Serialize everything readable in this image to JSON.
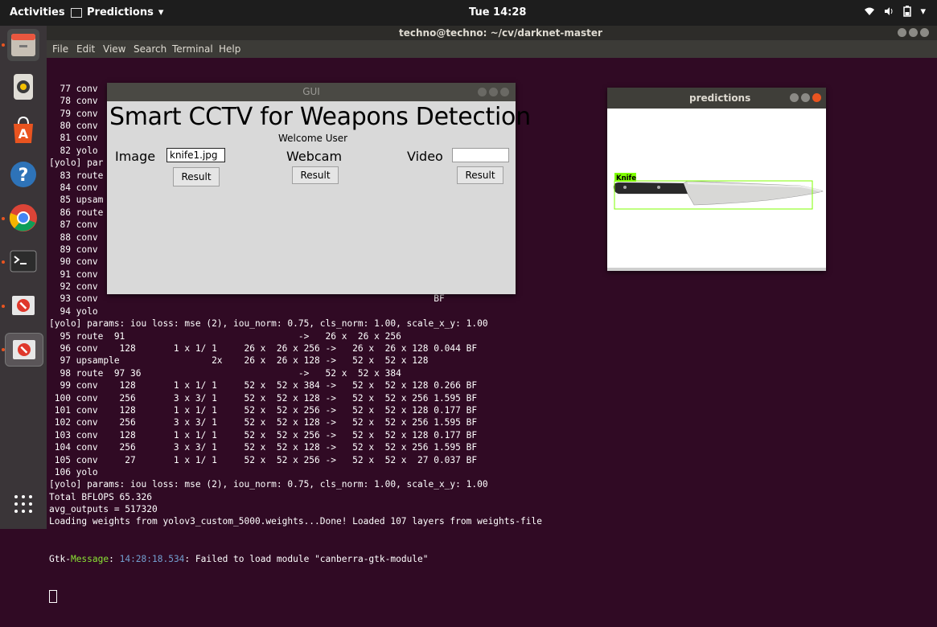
{
  "topbar": {
    "activities": "Activities",
    "app_name": "Predictions",
    "app_caret": "▾",
    "clock": "Tue 14:28",
    "wifi_icon": "wifi-icon",
    "volume_icon": "volume-icon",
    "battery_icon": "battery-icon",
    "caret": "▾"
  },
  "terminal": {
    "title": "techno@techno: ~/cv/darknet-master",
    "menu": [
      "File",
      "Edit",
      "View",
      "Search",
      "Terminal",
      "Help"
    ],
    "lines": [
      "  77 conv    512       1 x 1/ 1     13 x  13 x1024 ->   13 x  13 x 512 0.177 BF",
      "  78 conv   1024       3 x 3/ 1     13 x  13 x 512 ->   13 x  13 x1024 1.595 BF",
      "  79 conv                                                              BF",
      "  80 conv                                                              BF",
      "  81 conv                                                              BF",
      "  82 yolo",
      "[yolo] par                                                             1.00",
      "  83 route",
      "  84 conv                                                              BF",
      "  85 upsam",
      "  86 route",
      "  87 conv                                                              BF",
      "  88 conv                                                              BF",
      "  89 conv                                                              BF",
      "  90 conv                                                              BF",
      "  91 conv                                                              BF",
      "  92 conv                                                              BF",
      "  93 conv                                                              BF",
      "  94 yolo",
      "[yolo] params: iou loss: mse (2), iou_norm: 0.75, cls_norm: 1.00, scale_x_y: 1.00",
      "  95 route  91                                ->   26 x  26 x 256",
      "  96 conv    128       1 x 1/ 1     26 x  26 x 256 ->   26 x  26 x 128 0.044 BF",
      "  97 upsample                 2x    26 x  26 x 128 ->   52 x  52 x 128",
      "  98 route  97 36                             ->   52 x  52 x 384",
      "  99 conv    128       1 x 1/ 1     52 x  52 x 384 ->   52 x  52 x 128 0.266 BF",
      " 100 conv    256       3 x 3/ 1     52 x  52 x 128 ->   52 x  52 x 256 1.595 BF",
      " 101 conv    128       1 x 1/ 1     52 x  52 x 256 ->   52 x  52 x 128 0.177 BF",
      " 102 conv    256       3 x 3/ 1     52 x  52 x 128 ->   52 x  52 x 256 1.595 BF",
      " 103 conv    128       1 x 1/ 1     52 x  52 x 256 ->   52 x  52 x 128 0.177 BF",
      " 104 conv    256       3 x 3/ 1     52 x  52 x 128 ->   52 x  52 x 256 1.595 BF",
      " 105 conv     27       1 x 1/ 1     52 x  52 x 256 ->   52 x  52 x  27 0.037 BF",
      " 106 yolo",
      "[yolo] params: iou loss: mse (2), iou_norm: 0.75, cls_norm: 1.00, scale_x_y: 1.00",
      "Total BFLOPS 65.326",
      "avg_outputs = 517320",
      "Loading weights from yolov3_custom_5000.weights...Done! Loaded 107 layers from weights-file"
    ],
    "gtk_prefix": "Gtk-",
    "gtk_message": "Message",
    "gtk_colon": ": ",
    "gtk_time": "14:28:18.534",
    "gtk_rest": ": Failed to load module \"canberra-gtk-module\""
  },
  "gui": {
    "title": "GUI",
    "heading": "Smart CCTV for Weapons Detection",
    "welcome": "Welcome User",
    "image_label": "Image",
    "image_value": "knife1.jpg",
    "webcam_label": "Webcam",
    "video_label": "Video",
    "video_value": "",
    "result_image": "Result",
    "result_webcam": "Result",
    "result_video": "Result"
  },
  "predictions": {
    "title": "predictions",
    "detection_label": "Knife",
    "box_color": "#7fff00"
  },
  "colors": {
    "terminal_bg": "#300a24",
    "accent": "#e95420"
  }
}
